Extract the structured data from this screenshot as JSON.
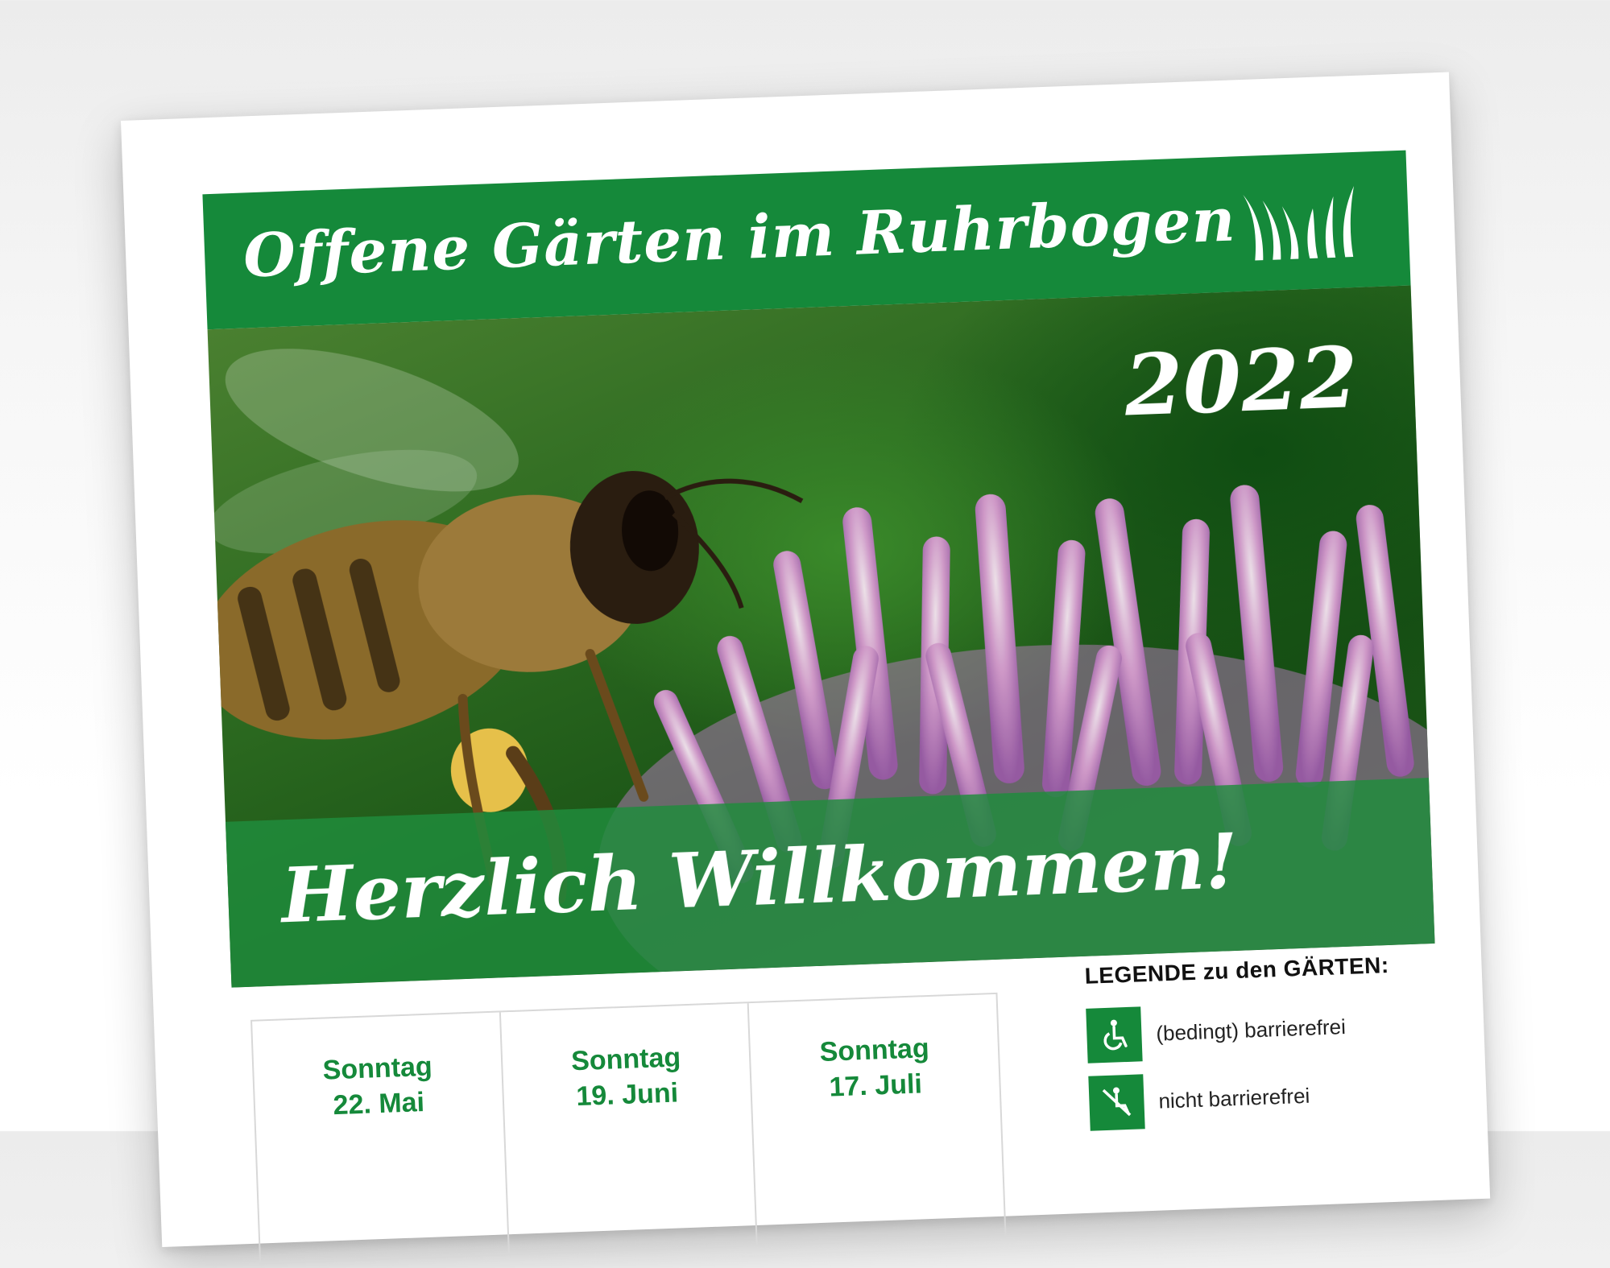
{
  "banner": {
    "title": "Offene Gärten im Ruhrbogen",
    "logo_icon": "grass-logo-icon"
  },
  "photo": {
    "year": "2022",
    "welcome": "Herzlich Willkommen!"
  },
  "dates": [
    {
      "day": "Sonntag",
      "date": "22. Mai"
    },
    {
      "day": "Sonntag",
      "date": "19. Juni"
    },
    {
      "day": "Sonntag",
      "date": "17. Juli"
    }
  ],
  "legend": {
    "title": "LEGENDE zu den GÄRTEN:",
    "items": [
      {
        "icon": "wheelchair-icon",
        "label": "(bedingt) barrierefrei"
      },
      {
        "icon": "not-accessible-icon",
        "label": "nicht barrierefrei"
      }
    ]
  },
  "colors": {
    "brand_green": "#15893a",
    "text": "#222222"
  }
}
